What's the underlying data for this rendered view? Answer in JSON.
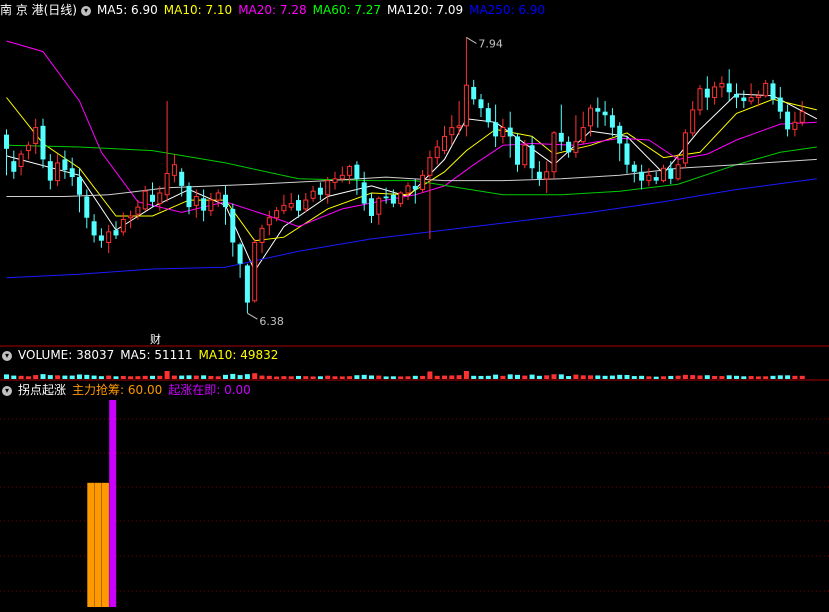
{
  "header": {
    "stock": "南 京 港(日线)",
    "ma": [
      {
        "label": "MA5: 6.90",
        "color": "#ffffff"
      },
      {
        "label": "MA10: 7.10",
        "color": "#ffff00"
      },
      {
        "label": "MA20: 7.28",
        "color": "#ff00ff"
      },
      {
        "label": "MA60: 7.27",
        "color": "#00ff00"
      },
      {
        "label": "MA120: 7.09",
        "color": "#ffffff"
      },
      {
        "label": "MA250: 6.90",
        "color": "#0000ff"
      }
    ]
  },
  "price": {
    "high_label": "7.94",
    "low_label": "6.38",
    "marker": "财",
    "candles": [
      [
        7.39,
        7.31,
        7.42,
        7.16
      ],
      [
        7.24,
        7.18,
        7.3,
        7.14
      ],
      [
        7.21,
        7.28,
        7.3,
        7.16
      ],
      [
        7.3,
        7.33,
        7.35,
        7.25
      ],
      [
        7.34,
        7.43,
        7.48,
        7.28
      ],
      [
        7.44,
        7.25,
        7.48,
        7.2
      ],
      [
        7.24,
        7.13,
        7.28,
        7.08
      ],
      [
        7.13,
        7.23,
        7.28,
        7.1
      ],
      [
        7.25,
        7.19,
        7.3,
        7.14
      ],
      [
        7.2,
        7.15,
        7.26,
        7.1
      ],
      [
        7.15,
        7.05,
        7.2,
        6.95
      ],
      [
        7.04,
        6.92,
        7.08,
        6.86
      ],
      [
        6.9,
        6.82,
        6.94,
        6.78
      ],
      [
        6.82,
        6.79,
        6.86,
        6.75
      ],
      [
        6.78,
        6.84,
        6.88,
        6.72
      ],
      [
        6.85,
        6.82,
        6.9,
        6.8
      ],
      [
        6.84,
        6.91,
        6.95,
        6.82
      ],
      [
        6.92,
        6.93,
        6.96,
        6.86
      ],
      [
        6.94,
        6.98,
        7.02,
        6.91
      ],
      [
        6.97,
        7.07,
        7.1,
        6.96
      ],
      [
        7.05,
        7.01,
        7.12,
        6.98
      ],
      [
        7.0,
        7.06,
        7.1,
        6.96
      ],
      [
        7.05,
        7.17,
        7.58,
        7.01
      ],
      [
        7.16,
        7.22,
        7.28,
        7.12
      ],
      [
        7.18,
        7.1,
        7.2,
        7.04
      ],
      [
        7.1,
        6.98,
        7.12,
        6.94
      ],
      [
        6.99,
        7.04,
        7.08,
        6.92
      ],
      [
        7.03,
        6.96,
        7.08,
        6.9
      ],
      [
        6.96,
        7.02,
        7.06,
        6.93
      ],
      [
        7.02,
        7.06,
        7.08,
        6.98
      ],
      [
        7.05,
        6.98,
        7.1,
        6.88
      ],
      [
        6.97,
        6.78,
        7.0,
        6.7
      ],
      [
        6.77,
        6.66,
        6.78,
        6.58
      ],
      [
        6.65,
        6.44,
        6.66,
        6.38
      ],
      [
        6.45,
        6.78,
        6.8,
        6.44
      ],
      [
        6.78,
        6.86,
        6.88,
        6.72
      ],
      [
        6.88,
        6.92,
        6.96,
        6.82
      ],
      [
        6.92,
        6.96,
        6.98,
        6.9
      ],
      [
        6.96,
        6.99,
        7.05,
        6.94
      ],
      [
        6.98,
        7.0,
        7.06,
        6.96
      ],
      [
        7.02,
        6.96,
        7.05,
        6.92
      ],
      [
        6.97,
        7.02,
        7.06,
        6.95
      ],
      [
        7.03,
        7.07,
        7.1,
        7.01
      ],
      [
        7.09,
        7.05,
        7.12,
        7.02
      ],
      [
        7.05,
        7.13,
        7.15,
        7.0
      ],
      [
        7.12,
        7.14,
        7.18,
        7.08
      ],
      [
        7.14,
        7.16,
        7.21,
        7.12
      ],
      [
        7.16,
        7.21,
        7.22,
        7.11
      ],
      [
        7.22,
        7.14,
        7.24,
        7.05
      ],
      [
        7.12,
        7.0,
        7.18,
        6.96
      ],
      [
        7.03,
        6.93,
        7.06,
        6.89
      ],
      [
        6.94,
        7.03,
        7.04,
        6.88
      ],
      [
        7.04,
        7.03,
        7.09,
        7.0
      ],
      [
        7.05,
        7.0,
        7.08,
        6.98
      ],
      [
        7.0,
        7.06,
        7.07,
        6.98
      ],
      [
        7.06,
        7.1,
        7.12,
        7.02
      ],
      [
        7.1,
        7.08,
        7.14,
        7.0
      ],
      [
        7.08,
        7.16,
        7.19,
        7.06
      ],
      [
        7.16,
        7.26,
        7.3,
        6.8
      ],
      [
        7.26,
        7.32,
        7.36,
        7.22
      ],
      [
        7.3,
        7.38,
        7.44,
        7.28
      ],
      [
        7.39,
        7.43,
        7.5,
        7.33
      ],
      [
        7.43,
        7.44,
        7.58,
        7.39
      ],
      [
        7.44,
        7.67,
        7.94,
        7.38
      ],
      [
        7.66,
        7.59,
        7.7,
        7.56
      ],
      [
        7.59,
        7.54,
        7.62,
        7.49
      ],
      [
        7.54,
        7.46,
        7.57,
        7.43
      ],
      [
        7.46,
        7.38,
        7.56,
        7.32
      ],
      [
        7.38,
        7.43,
        7.48,
        7.34
      ],
      [
        7.43,
        7.38,
        7.52,
        7.26
      ],
      [
        7.38,
        7.22,
        7.4,
        7.18
      ],
      [
        7.22,
        7.33,
        7.36,
        7.2
      ],
      [
        7.33,
        7.2,
        7.38,
        7.14
      ],
      [
        7.18,
        7.14,
        7.24,
        7.1
      ],
      [
        7.14,
        7.18,
        7.24,
        7.06
      ],
      [
        7.18,
        7.4,
        7.41,
        7.14
      ],
      [
        7.4,
        7.35,
        7.56,
        7.3
      ],
      [
        7.35,
        7.29,
        7.38,
        7.26
      ],
      [
        7.29,
        7.35,
        7.5,
        7.26
      ],
      [
        7.35,
        7.43,
        7.52,
        7.34
      ],
      [
        7.44,
        7.54,
        7.56,
        7.38
      ],
      [
        7.54,
        7.52,
        7.6,
        7.43
      ],
      [
        7.52,
        7.5,
        7.58,
        7.44
      ],
      [
        7.5,
        7.43,
        7.54,
        7.38
      ],
      [
        7.44,
        7.34,
        7.46,
        7.24
      ],
      [
        7.34,
        7.22,
        7.38,
        7.17
      ],
      [
        7.22,
        7.18,
        7.24,
        7.12
      ],
      [
        7.18,
        7.13,
        7.22,
        7.08
      ],
      [
        7.13,
        7.16,
        7.2,
        7.1
      ],
      [
        7.15,
        7.13,
        7.18,
        7.11
      ],
      [
        7.13,
        7.2,
        7.22,
        7.12
      ],
      [
        7.2,
        7.14,
        7.24,
        7.11
      ],
      [
        7.14,
        7.22,
        7.28,
        7.13
      ],
      [
        7.23,
        7.4,
        7.42,
        7.2
      ],
      [
        7.4,
        7.53,
        7.58,
        7.38
      ],
      [
        7.53,
        7.65,
        7.67,
        7.5
      ],
      [
        7.65,
        7.6,
        7.72,
        7.53
      ],
      [
        7.6,
        7.66,
        7.69,
        7.56
      ],
      [
        7.66,
        7.68,
        7.72,
        7.6
      ],
      [
        7.68,
        7.63,
        7.76,
        7.58
      ],
      [
        7.62,
        7.6,
        7.68,
        7.54
      ],
      [
        7.6,
        7.58,
        7.64,
        7.54
      ],
      [
        7.58,
        7.6,
        7.68,
        7.56
      ],
      [
        7.6,
        7.61,
        7.64,
        7.55
      ],
      [
        7.61,
        7.68,
        7.7,
        7.6
      ],
      [
        7.68,
        7.59,
        7.7,
        7.56
      ],
      [
        7.6,
        7.52,
        7.66,
        7.48
      ],
      [
        7.52,
        7.42,
        7.56,
        7.38
      ],
      [
        7.42,
        7.46,
        7.52,
        7.38
      ],
      [
        7.46,
        7.52,
        7.58,
        7.44
      ]
    ],
    "ma_series": {
      "ma5": [
        [
          0,
          7.27
        ],
        [
          10,
          7.16
        ],
        [
          15,
          6.85
        ],
        [
          20,
          6.98
        ],
        [
          25,
          7.08
        ],
        [
          30,
          6.99
        ],
        [
          34,
          6.62
        ],
        [
          38,
          6.87
        ],
        [
          44,
          7.04
        ],
        [
          50,
          7.1
        ],
        [
          55,
          7.04
        ],
        [
          60,
          7.25
        ],
        [
          63,
          7.48
        ],
        [
          67,
          7.46
        ],
        [
          72,
          7.31
        ],
        [
          75,
          7.22
        ],
        [
          80,
          7.41
        ],
        [
          85,
          7.38
        ],
        [
          90,
          7.17
        ],
        [
          95,
          7.42
        ],
        [
          100,
          7.62
        ],
        [
          105,
          7.61
        ],
        [
          111,
          7.48
        ]
      ],
      "ma10": [
        [
          0,
          7.6
        ],
        [
          5,
          7.34
        ],
        [
          10,
          7.2
        ],
        [
          15,
          6.93
        ],
        [
          20,
          6.93
        ],
        [
          25,
          7.02
        ],
        [
          30,
          7.02
        ],
        [
          34,
          6.79
        ],
        [
          38,
          6.81
        ],
        [
          44,
          6.97
        ],
        [
          50,
          7.06
        ],
        [
          55,
          7.05
        ],
        [
          60,
          7.18
        ],
        [
          63,
          7.3
        ],
        [
          67,
          7.42
        ],
        [
          72,
          7.38
        ],
        [
          75,
          7.28
        ],
        [
          80,
          7.33
        ],
        [
          85,
          7.4
        ],
        [
          90,
          7.26
        ],
        [
          95,
          7.29
        ],
        [
          100,
          7.51
        ],
        [
          105,
          7.59
        ],
        [
          111,
          7.53
        ]
      ],
      "ma20": [
        [
          0,
          7.92
        ],
        [
          5,
          7.86
        ],
        [
          10,
          7.58
        ],
        [
          13,
          7.29
        ],
        [
          18,
          7.01
        ],
        [
          24,
          6.95
        ],
        [
          30,
          7.01
        ],
        [
          36,
          6.93
        ],
        [
          40,
          6.87
        ],
        [
          46,
          6.97
        ],
        [
          52,
          7.02
        ],
        [
          56,
          7.05
        ],
        [
          60,
          7.1
        ],
        [
          64,
          7.22
        ],
        [
          68,
          7.33
        ],
        [
          72,
          7.34
        ],
        [
          78,
          7.33
        ],
        [
          84,
          7.37
        ],
        [
          88,
          7.36
        ],
        [
          92,
          7.25
        ],
        [
          96,
          7.28
        ],
        [
          100,
          7.36
        ],
        [
          106,
          7.45
        ],
        [
          111,
          7.46
        ]
      ],
      "ma60": [
        [
          0,
          7.33
        ],
        [
          10,
          7.32
        ],
        [
          20,
          7.3
        ],
        [
          30,
          7.23
        ],
        [
          40,
          7.14
        ],
        [
          50,
          7.13
        ],
        [
          56,
          7.13
        ],
        [
          62,
          7.09
        ],
        [
          68,
          7.05
        ],
        [
          76,
          7.05
        ],
        [
          84,
          7.07
        ],
        [
          92,
          7.11
        ],
        [
          100,
          7.22
        ],
        [
          106,
          7.29
        ],
        [
          111,
          7.32
        ]
      ],
      "ma120": [
        [
          0,
          7.04
        ],
        [
          8,
          7.04
        ],
        [
          14,
          7.05
        ],
        [
          22,
          7.09
        ],
        [
          34,
          7.11
        ],
        [
          44,
          7.13
        ],
        [
          52,
          7.15
        ],
        [
          60,
          7.13
        ],
        [
          68,
          7.13
        ],
        [
          76,
          7.14
        ],
        [
          84,
          7.16
        ],
        [
          92,
          7.2
        ],
        [
          100,
          7.22
        ],
        [
          111,
          7.25
        ]
      ],
      "ma250": [
        [
          0,
          6.58
        ],
        [
          10,
          6.6
        ],
        [
          20,
          6.63
        ],
        [
          30,
          6.64
        ],
        [
          40,
          6.73
        ],
        [
          50,
          6.8
        ],
        [
          60,
          6.85
        ],
        [
          70,
          6.9
        ],
        [
          80,
          6.95
        ],
        [
          90,
          7.01
        ],
        [
          100,
          7.08
        ],
        [
          111,
          7.14
        ]
      ]
    }
  },
  "volume": {
    "label": "VOLUME: 38037",
    "ma5": "MA5: 51111",
    "ma10": "MA10: 49832",
    "colors": {
      "label": "#ffffff",
      "ma5": "#ffffff",
      "ma10": "#ffff00"
    }
  },
  "indicator": {
    "name": "拐点起涨",
    "line1": "主力抢筹: 60.00",
    "line2": "起涨在即: 0.00",
    "colors": {
      "line1": "#ff9900",
      "line2": "#cc00ff"
    },
    "bars": [
      {
        "index": 11,
        "value": 60,
        "color": "#ff9900"
      },
      {
        "index": 12,
        "value": 60,
        "color": "#ff9900"
      },
      {
        "index": 13,
        "value": 60,
        "color": "#ff9900"
      },
      {
        "index": 14,
        "value": 100,
        "color": "#cc00ff"
      }
    ]
  }
}
